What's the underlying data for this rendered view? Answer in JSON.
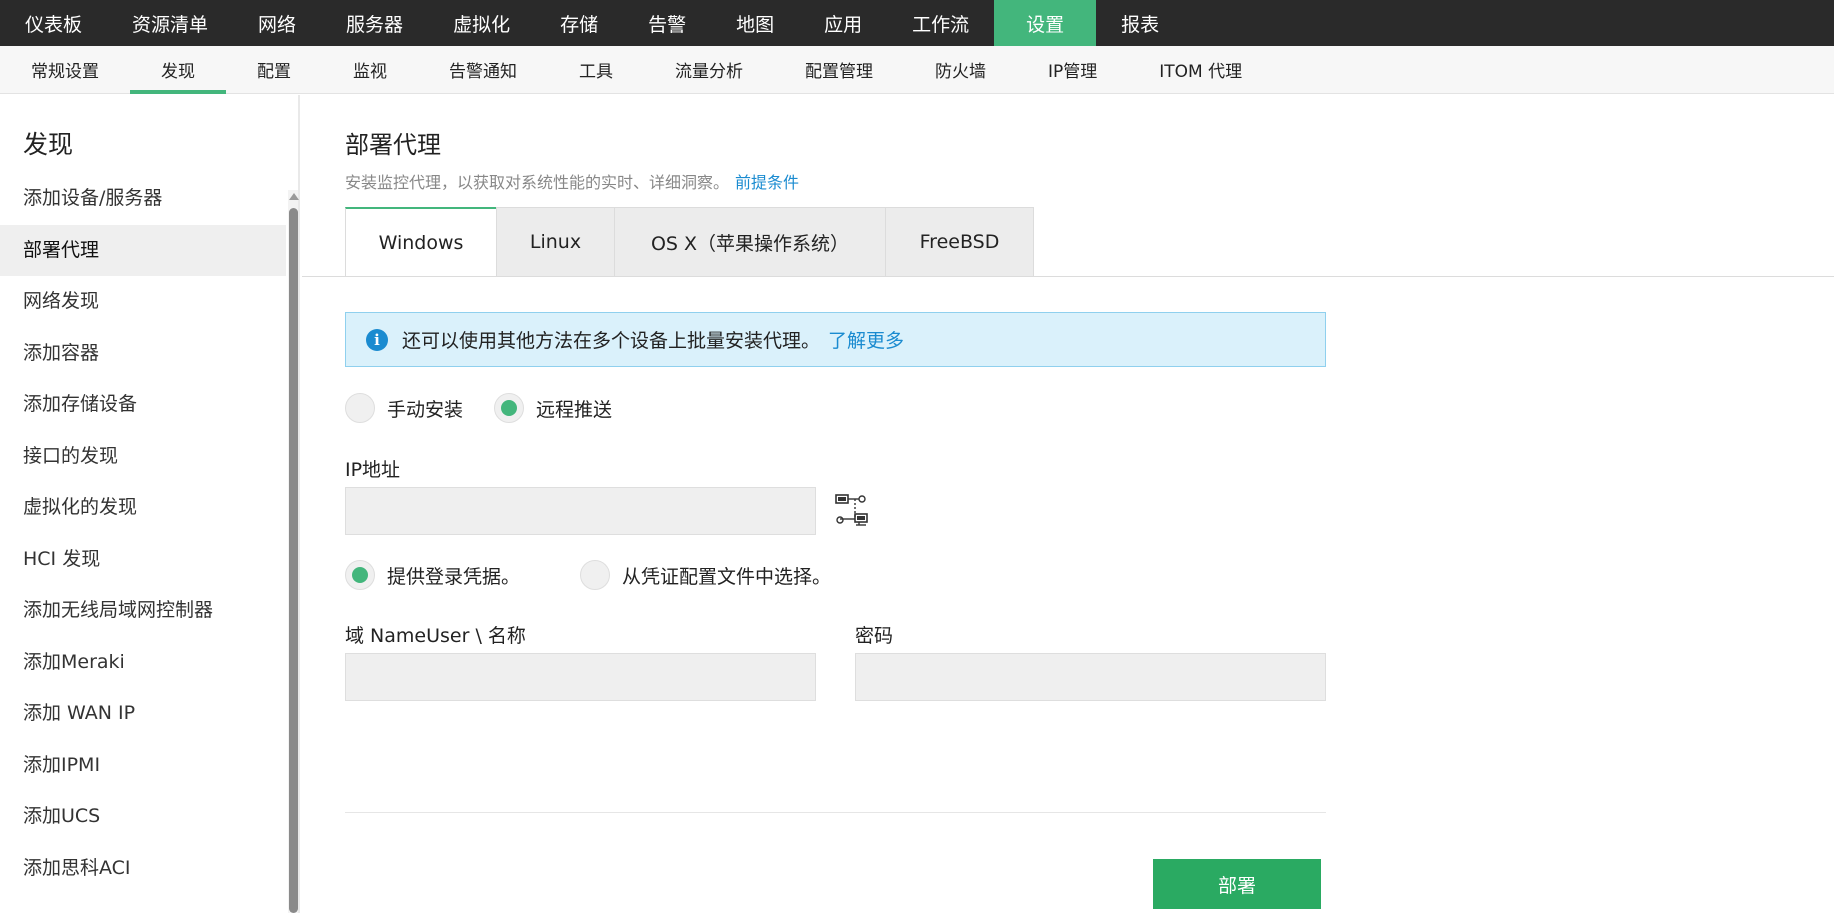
{
  "topnav": {
    "items": [
      "仪表板",
      "资源清单",
      "网络",
      "服务器",
      "虚拟化",
      "存储",
      "告警",
      "地图",
      "应用",
      "工作流",
      "设置",
      "报表"
    ],
    "active_index": 10
  },
  "subnav": {
    "items": [
      "常规设置",
      "发现",
      "配置",
      "监视",
      "告警通知",
      "工具",
      "流量分析",
      "配置管理",
      "防火墙",
      "IP管理",
      "ITOM 代理"
    ],
    "active_index": 1
  },
  "sidebar": {
    "title": "发现",
    "items": [
      "添加设备/服务器",
      "部署代理",
      "网络发现",
      "添加容器",
      "添加存储设备",
      "接口的发现",
      "虚拟化的发现",
      "HCI 发现",
      "添加无线局域网控制器",
      "添加Meraki",
      "添加 WAN IP",
      "添加IPMI",
      "添加UCS",
      "添加思科ACI"
    ],
    "active_index": 1
  },
  "main": {
    "title": "部署代理",
    "description": "安装监控代理，以获取对系统性能的实时、详细洞察。",
    "prereq_link": "前提条件",
    "tabs": [
      "Windows",
      "Linux",
      "OS X（苹果操作系统）",
      "FreeBSD"
    ],
    "active_tab": 0,
    "info": {
      "text": "还可以使用其他方法在多个设备上批量安装代理。",
      "link": "了解更多"
    },
    "install_mode": {
      "options": [
        "手动安装",
        "远程推送"
      ],
      "selected": 1
    },
    "ip_label": "IP地址",
    "ip_value": "",
    "credential_mode": {
      "options": [
        "提供登录凭据。",
        "从凭证配置文件中选择。"
      ],
      "selected": 0
    },
    "username_label": "域 NameUser \\ 名称",
    "username_value": "",
    "password_label": "密码",
    "password_value": "",
    "deploy_button": "部署"
  },
  "colors": {
    "accent": "#43b67c",
    "deploy_button": "#2aaa62",
    "link": "#1a8bd0",
    "info_bg": "#daf1fb",
    "topnav_bg": "#2a2a2a"
  },
  "icons": {
    "info": "info-icon",
    "ip_picker": "network-topology-icon"
  }
}
